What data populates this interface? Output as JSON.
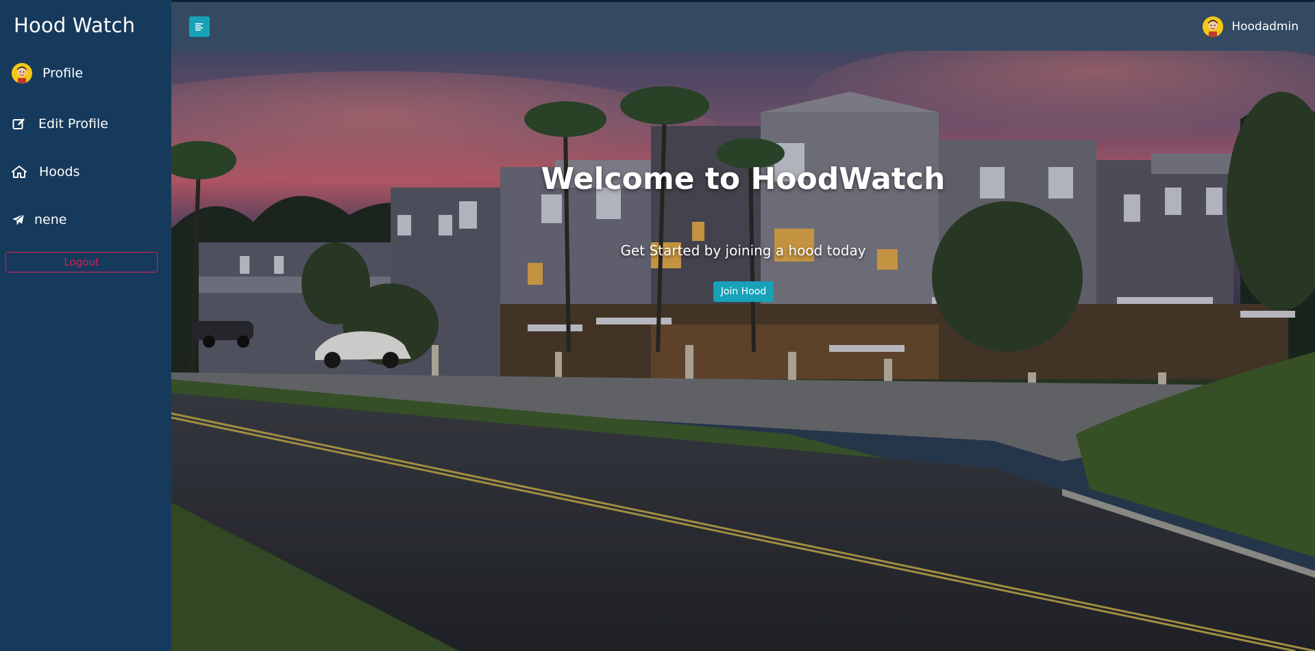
{
  "sidebar": {
    "brand": "Hood Watch",
    "items": [
      {
        "label": "Profile",
        "icon": "avatar-image"
      },
      {
        "label": "Edit Profile",
        "icon": "edit-icon"
      },
      {
        "label": "Hoods",
        "icon": "home-icon"
      },
      {
        "label": "nene",
        "icon": "paper-plane-icon"
      }
    ],
    "logout_label": "Logout"
  },
  "topbar": {
    "toggle_icon": "menu-lines-icon",
    "username": "Hoodadmin"
  },
  "hero": {
    "title": "Welcome to HoodWatch",
    "subtitle": "Get Started by joining a hood today",
    "cta_label": "Join Hood"
  },
  "colors": {
    "sidebar_bg": "#163a5c",
    "topbar_bg": "#344a63",
    "accent": "#17a2b8",
    "logout": "#dc1f52"
  }
}
